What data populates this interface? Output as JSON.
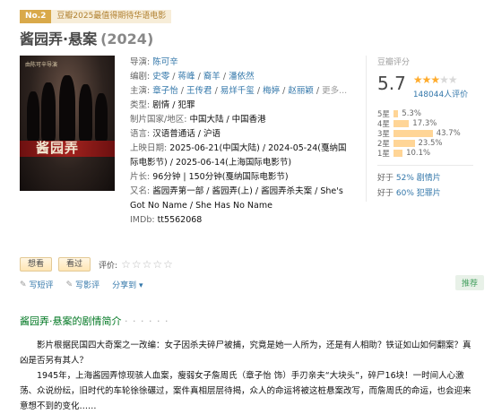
{
  "rank": {
    "no": "No.2",
    "text": "豆瓣2025最值得期待华语电影"
  },
  "title": {
    "main": "酱园弄·悬案",
    "year": "(2024)"
  },
  "poster": {
    "top_text": "由陈可辛导演",
    "logo": "酱园弄"
  },
  "info": {
    "director_label": "导演:",
    "director": "陈可辛",
    "writer_label": "编剧:",
    "writers": [
      "史零",
      "蒋峰",
      "裔羊",
      "潘依然"
    ],
    "cast_label": "主演:",
    "cast": [
      "章子怡",
      "王传君",
      "易烊千玺",
      "梅婷",
      "赵丽颖"
    ],
    "more": "更多...",
    "genre_label": "类型:",
    "genre": "剧情 / 犯罪",
    "country_label": "制片国家/地区:",
    "country": "中国大陆 / 中国香港",
    "language_label": "语言:",
    "language": "汉语普通话 / 沪语",
    "release_label": "上映日期:",
    "release": "2025-06-21(中国大陆) / 2024-05-24(戛纳国际电影节) / 2025-06-14(上海国际电影节)",
    "runtime_label": "片长:",
    "runtime": "96分钟 | 150分钟(戛纳国际电影节)",
    "aka_label": "又名:",
    "aka": "酱园弄第一部 / 酱园弄(上) / 酱园弄杀夫案 / She's Got No Name / She Has No Name",
    "imdb_label": "IMDb:",
    "imdb": "tt5562068"
  },
  "rating": {
    "header": "豆瓣评分",
    "score": "5.7",
    "stars_full": "★★★",
    "stars_empty": "★★",
    "votes": "148044人评价",
    "bars": [
      {
        "label": "5星",
        "pct": "5.3%",
        "value": 5.3
      },
      {
        "label": "4星",
        "pct": "17.3%",
        "value": 17.3
      },
      {
        "label": "3星",
        "pct": "43.7%",
        "value": 43.7
      },
      {
        "label": "2星",
        "pct": "23.5%",
        "value": 23.5
      },
      {
        "label": "1星",
        "pct": "10.1%",
        "value": 10.1
      }
    ],
    "better1_prefix": "好于",
    "better1_pct": "52%",
    "better1_genre": "剧情片",
    "better2_prefix": "好于",
    "better2_pct": "60%",
    "better2_genre": "犯罪片"
  },
  "actions": {
    "want": "想看",
    "seen": "看过",
    "rate_label": "评价:",
    "rate_stars": "☆☆☆☆☆"
  },
  "ops": {
    "write_short": "写短评",
    "write_review": "写影评",
    "share": "分享到 ▾",
    "recommend": "推荐"
  },
  "section": {
    "title": "酱园弄·悬案的剧情简介",
    "dots": "· · · · · ·"
  },
  "synopsis": [
    "影片根据民国四大奇案之一改编：女子因杀夫碎尸被捕，究竟是她一人所为，还是有人相助？铁证如山如何翻案？真凶是否另有其人？",
    "1945年，上海酱园弄惊现骇人血案，瘦弱女子詹周氏（章子怡 饰）手刃亲夫“大块头”，碎尸16块！一时间人心激荡、众说纷纭，旧时代的车轮徐徐碾过，案件真相层层待揭，众人的命运将被这桩悬案改写，而詹周氏的命运，也会迎来意想不到的变化……"
  ]
}
